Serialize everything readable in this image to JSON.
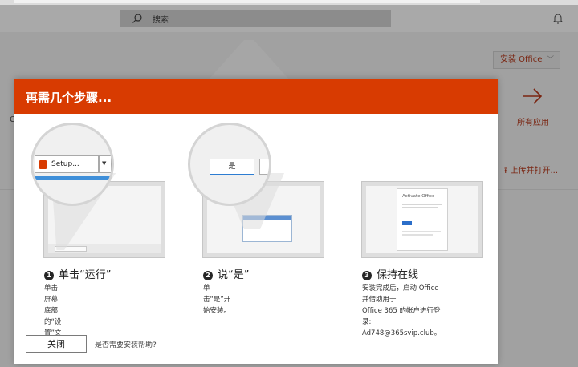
{
  "background": {
    "search": {
      "placeholder": "搜索"
    },
    "install_button": {
      "label": "安装 Office",
      "chevron": "﹀"
    },
    "all_apps": {
      "label": "所有应用",
      "icon": "arrow-right-icon"
    },
    "upload": {
      "label": "上传并打开...",
      "icon": "upload-arrow-icon"
    },
    "left_char": "C"
  },
  "dialog": {
    "title": "再需几个步骤...",
    "accent": "#d83b01",
    "steps": [
      {
        "number": "1",
        "heading": "单击“运行”",
        "description": "单击屏幕底部的“设置”文件。",
        "magnifier": {
          "button_label": "Setup..."
        }
      },
      {
        "number": "2",
        "heading": "说“是”",
        "description": "单击“是”开始安装。",
        "magnifier": {
          "button_label": "是"
        }
      },
      {
        "number": "3",
        "heading": "保持在线",
        "description_lines": [
          "安装完成后，启动 Office 并借助用于",
          "Office 365 的帐户进行登录:",
          "Ad748@365svip.club。"
        ],
        "window_title": "Activate Office"
      }
    ],
    "close_button": "关闭",
    "help_link": "是否需要安装帮助?"
  }
}
